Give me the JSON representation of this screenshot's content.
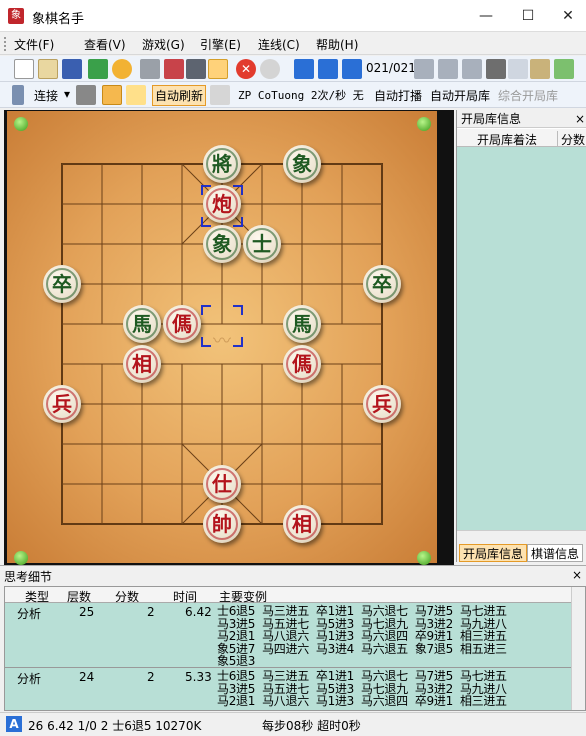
{
  "window": {
    "title": "象棋名手",
    "app_icon": "象",
    "min": "—",
    "max": "☐",
    "close": "✕"
  },
  "menu": {
    "file": "文件(F)",
    "view": "查看(V)",
    "game": "游戏(G)",
    "engine": "引擎(E)",
    "online": "连线(C)",
    "help": "帮助(H)"
  },
  "toolbar1": {
    "move_counter": "021/021"
  },
  "toolbar2": {
    "connect": "连接",
    "auto_refresh": "自动刷新",
    "engine_status": "ZP CoTuong 2次/秒 无",
    "auto_play": "自动打播",
    "auto_opening": "自动开局库",
    "combined_opening": "综合开局库"
  },
  "board": {
    "pieces": [
      {
        "char": "將",
        "side": "green"
      },
      {
        "char": "象",
        "side": "green"
      },
      {
        "char": "炮",
        "side": "red"
      },
      {
        "char": "象",
        "side": "green"
      },
      {
        "char": "士",
        "side": "green"
      },
      {
        "char": "卒",
        "side": "green"
      },
      {
        "char": "卒",
        "side": "green"
      },
      {
        "char": "馬",
        "side": "green"
      },
      {
        "char": "傌",
        "side": "red"
      },
      {
        "char": "馬",
        "side": "green"
      },
      {
        "char": "相",
        "side": "red"
      },
      {
        "char": "傌",
        "side": "red"
      },
      {
        "char": "兵",
        "side": "red"
      },
      {
        "char": "兵",
        "side": "red"
      },
      {
        "char": "仕",
        "side": "red"
      },
      {
        "char": "帥",
        "side": "red"
      },
      {
        "char": "相",
        "side": "red"
      }
    ]
  },
  "opening_panel": {
    "title": "开局库信息",
    "col_move": "开局库着法",
    "col_score": "分数",
    "tab_opening": "开局库信息",
    "tab_notes": "棋谱信息",
    "close": "×"
  },
  "analysis": {
    "title": "思考细节",
    "close": "×",
    "headers": {
      "type": "类型",
      "depth": "层数",
      "score": "分数",
      "time": "时间",
      "variation": "主要变例"
    },
    "rows": [
      {
        "type": "分析",
        "depth": "25",
        "score": "2",
        "time": "6.42",
        "variation": "士6退5  马三进五  卒1进1  马六退七  马7进5  马七进五\n马3进5  马五进七  马5进3  马七退九  马3进2  马九进八\n马2退1  马八退六  马1进3  马六退四  卒9进1  相三进五\n象5进7  马四进六  马3进4  马六退五  象7退5  相五进三\n象5退3"
      },
      {
        "type": "分析",
        "depth": "24",
        "score": "2",
        "time": "5.33",
        "variation": "士6退5  马三进五  卒1进1  马六退七  马7进5  马七进五\n马3进5  马五进七  马5进3  马七退九  马3进2  马九进八\n马2退1  马八退六  马1进3  马六退四  卒9进1  相三进五"
      }
    ]
  },
  "status": {
    "badge": "A",
    "info": "26 6.42 1/0 2 士6退5  10270K",
    "timing": "每步08秒 超时0秒"
  }
}
